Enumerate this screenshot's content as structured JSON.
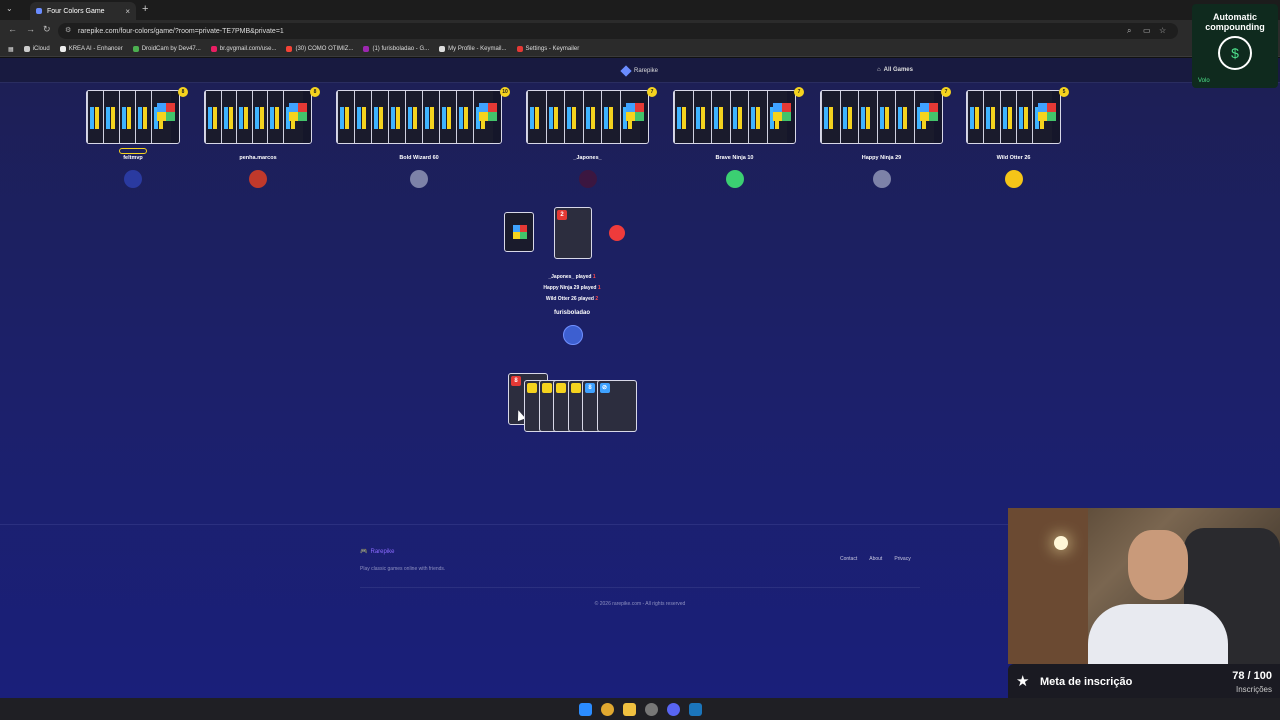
{
  "browser": {
    "tab_title": "Four Colors Game",
    "tab_close": "×",
    "new_tab": "+",
    "url": "rarepike.com/four-colors/game/?room=private-TE7PMB&private=1",
    "bookmarks": [
      "iCloud",
      "KREA AI - Enhancer",
      "DroidCam by Dev47...",
      "br.gvgmail.com/use...",
      "(30) COMO OTIMIZ...",
      "(1) furisboladao - G...",
      "My Profile - Keymail...",
      "Settings - Keymailer"
    ]
  },
  "site": {
    "brand": "Rarepike",
    "all_games": "All Games"
  },
  "players": [
    {
      "name": "feltmvp",
      "count": "8",
      "cards": 5,
      "avatar_color": "#2a3aa0"
    },
    {
      "name": "penha.marcos",
      "count": "8",
      "cards": 6,
      "avatar_color": "#c0392b"
    },
    {
      "name": "Bold Wizard 60",
      "count": "10",
      "cards": 9,
      "avatar_color": "#7d82a8"
    },
    {
      "name": "_Japones_",
      "count": "7",
      "cards": 6,
      "avatar_color": "#3b1640"
    },
    {
      "name": "Brave Ninja 10",
      "count": "7",
      "cards": 6,
      "avatar_color": "#3bcf72"
    },
    {
      "name": "Happy Ninja 29",
      "count": "7",
      "cards": 6,
      "avatar_color": "#7d82a8"
    },
    {
      "name": "Wild Otter 26",
      "count": "5",
      "cards": 5,
      "avatar_color": "#f5c518"
    }
  ],
  "table": {
    "discard_value": "2",
    "discard_color": "#e53935",
    "log": [
      {
        "text": "_Japones_ played",
        "num": "1"
      },
      {
        "text": "Happy Ninja 29 played",
        "num": "1"
      },
      {
        "text": "Wild Otter 26 played",
        "num": "2"
      }
    ],
    "current_player": "furisboladao"
  },
  "my_hand": [
    {
      "value": "8",
      "color": "#e53935"
    },
    {
      "value": "",
      "color": "#f5d31e"
    },
    {
      "value": "",
      "color": "#f5d31e"
    },
    {
      "value": "",
      "color": "#f5d31e"
    },
    {
      "value": "",
      "color": "#f5d31e"
    },
    {
      "value": "8",
      "color": "#3fa2ff"
    },
    {
      "value": "⊘",
      "color": "#3fa2ff"
    }
  ],
  "footer": {
    "brand": "Rarepike",
    "tagline": "Play classic games online with friends.",
    "links": [
      "Contact",
      "About",
      "Privacy"
    ],
    "copyright": "© 2026 rarepike.com - All rights reserved"
  },
  "overlay": {
    "auto_line1": "Automatic",
    "auto_line2": "compounding",
    "auto_brand": "Volo",
    "goal_title": "Meta de inscrição",
    "goal_count": "78 / 100",
    "goal_label": "Inscrições",
    "goal_progress": 0.78
  }
}
